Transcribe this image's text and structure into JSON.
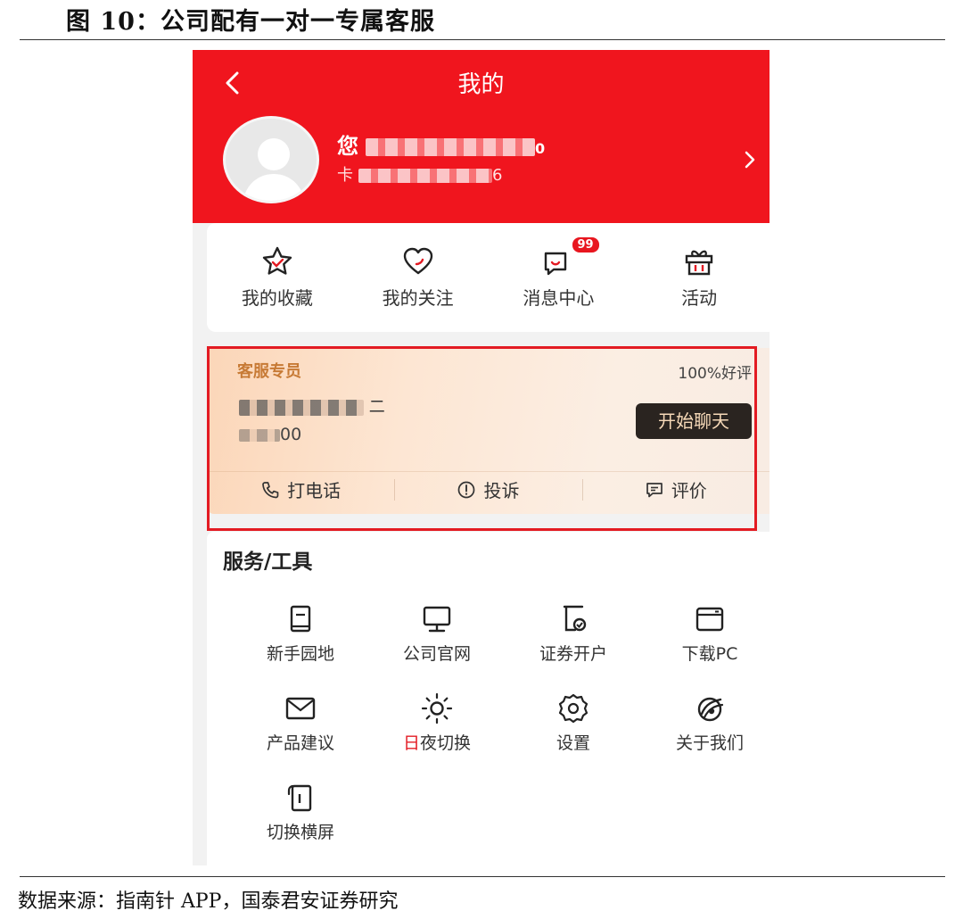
{
  "figure": {
    "title": "图 10：公司配有一对一专属客服",
    "source": "数据来源：指南针 APP，国泰君安证券研究"
  },
  "header": {
    "title": "我的",
    "user_name_prefix": "您",
    "user_name_suffix": "0",
    "card_prefix": "卡",
    "card_suffix": "6"
  },
  "quick_actions": [
    {
      "label": "我的收藏",
      "icon": "star-check-icon"
    },
    {
      "label": "我的关注",
      "icon": "heart-icon"
    },
    {
      "label": "消息中心",
      "icon": "message-icon",
      "badge": "99"
    },
    {
      "label": "活动",
      "icon": "gift-icon"
    }
  ],
  "service_card": {
    "tag": "客服专员",
    "rating": "100%好评",
    "name_suffix": "二",
    "id_suffix": "00",
    "chat_button": "开始聊天",
    "actions": [
      {
        "label": "打电话",
        "icon": "phone-icon"
      },
      {
        "label": "投诉",
        "icon": "alert-icon"
      },
      {
        "label": "评价",
        "icon": "comment-icon"
      }
    ]
  },
  "tools": {
    "title": "服务/工具",
    "items": [
      {
        "label": "新手园地",
        "icon": "book-icon"
      },
      {
        "label": "公司官网",
        "icon": "monitor-icon"
      },
      {
        "label": "证券开户",
        "icon": "account-open-icon"
      },
      {
        "label": "下载PC",
        "icon": "window-icon"
      },
      {
        "label": "产品建议",
        "icon": "mail-icon"
      },
      {
        "label_red": "日",
        "label_rest": "夜切换",
        "icon": "sun-icon"
      },
      {
        "label": "设置",
        "icon": "settings-icon"
      },
      {
        "label": "关于我们",
        "icon": "about-icon"
      },
      {
        "label": "切换横屏",
        "icon": "rotate-screen-icon"
      }
    ]
  },
  "colors": {
    "brand_red": "#f0151e",
    "chat_button_bg": "#2a2420",
    "highlight_border": "#e31b23"
  }
}
